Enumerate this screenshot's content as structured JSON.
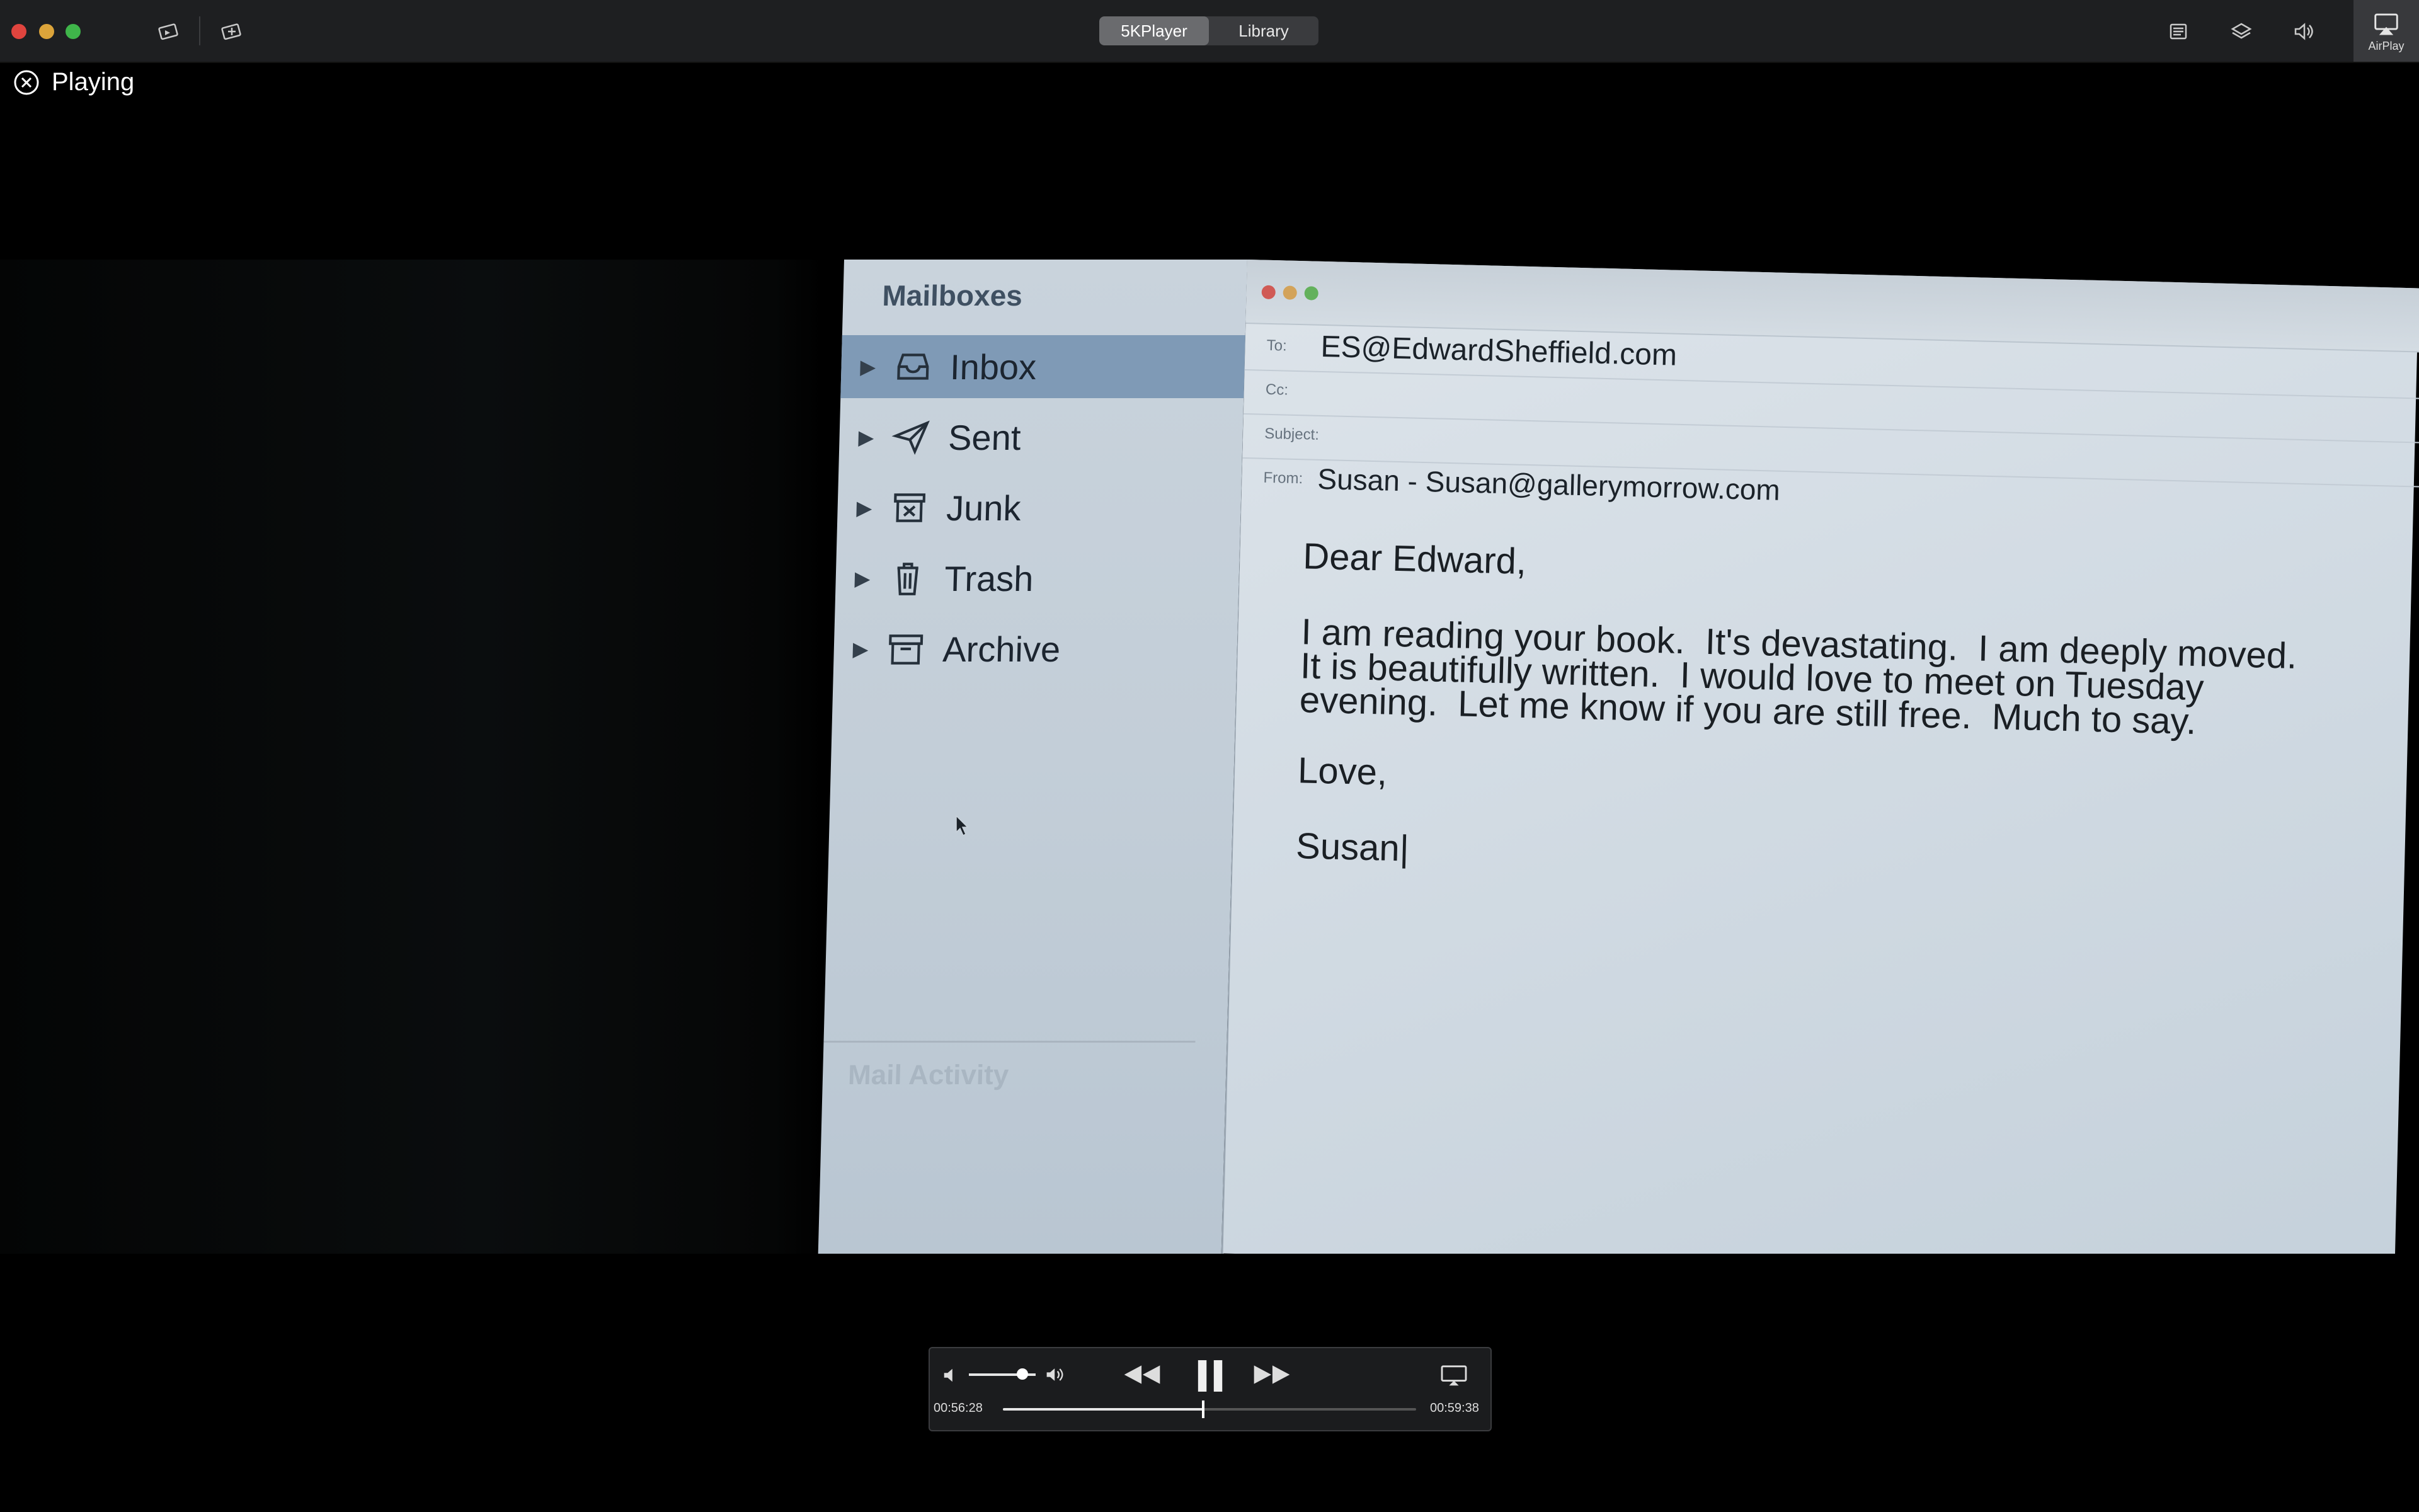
{
  "app": {
    "tabs": [
      "5KPlayer",
      "Library"
    ],
    "active_tab": "5KPlayer",
    "airplay_label": "AirPlay",
    "status": "Playing"
  },
  "video_frame": {
    "mailboxes_title": "Mailboxes",
    "mailboxes": [
      {
        "label": "Inbox",
        "icon": "inbox-icon",
        "selected": true
      },
      {
        "label": "Sent",
        "icon": "sent-icon",
        "selected": false
      },
      {
        "label": "Junk",
        "icon": "junk-icon",
        "selected": false
      },
      {
        "label": "Trash",
        "icon": "trash-icon",
        "selected": false
      },
      {
        "label": "Archive",
        "icon": "archive-icon",
        "selected": false
      }
    ],
    "mail_activity": "Mail Activity",
    "fields": {
      "to_label": "To:",
      "to_value": "ES@EdwardSheffield.com",
      "cc_label": "Cc:",
      "subject_label": "Subject:",
      "from_label": "From:",
      "from_value": "Susan - Susan@gallerymorrow.com"
    },
    "body": {
      "greeting": "Dear Edward,",
      "line1": "I am reading your book.  It's devastating.  I am deeply moved.",
      "line2": "It is beautifully written.  I would love to meet on Tuesday",
      "line3": "evening.  Let me know if you are still free.  Much to say.",
      "closing": "Love,",
      "signature": "Susan|"
    }
  },
  "controls": {
    "elapsed": "00:56:28",
    "total": "00:59:38",
    "progress": 0.485,
    "volume": 0.8
  },
  "colors": {
    "titlebar": "#1e1f21",
    "close": "#ec6a5e",
    "minimize": "#f4bf4f",
    "zoom": "#61c554"
  }
}
